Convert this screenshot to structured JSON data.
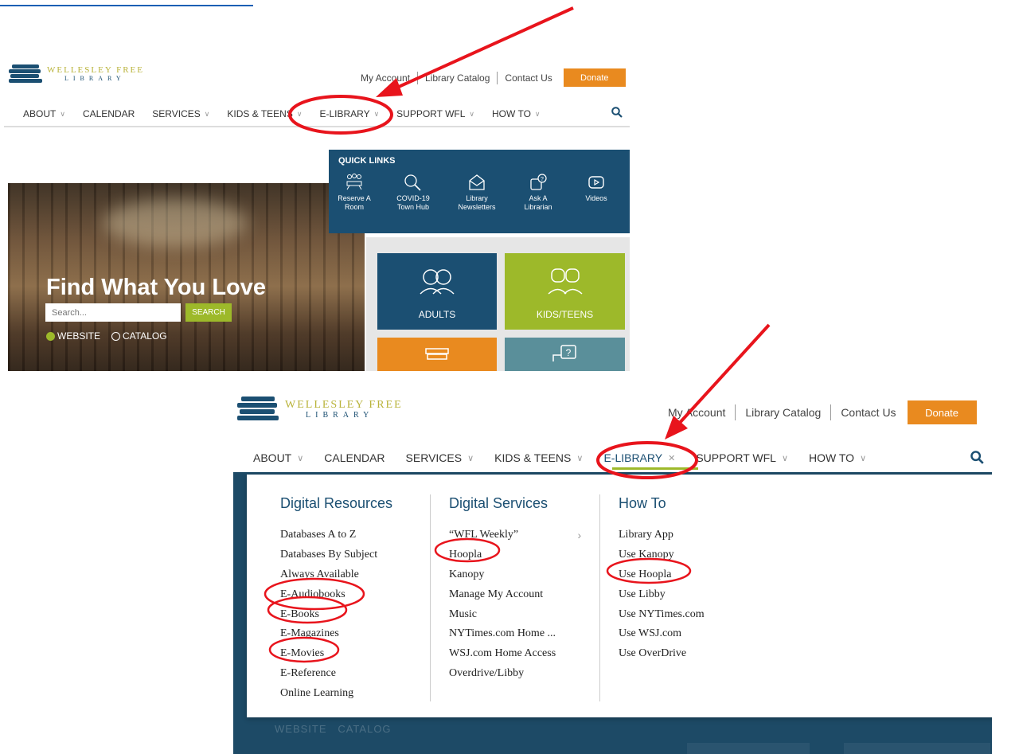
{
  "site": {
    "logo_line1": "WELLESLEY FREE",
    "logo_line2": "LIBRARY"
  },
  "utility": {
    "my_account": "My Account",
    "library_catalog": "Library Catalog",
    "contact_us": "Contact Us",
    "donate": "Donate"
  },
  "nav": [
    {
      "label": "ABOUT",
      "chevron": true
    },
    {
      "label": "CALENDAR",
      "chevron": false
    },
    {
      "label": "SERVICES",
      "chevron": true
    },
    {
      "label": "KIDS & TEENS",
      "chevron": true
    },
    {
      "label": "E-LIBRARY",
      "chevron": true
    },
    {
      "label": "SUPPORT WFL",
      "chevron": true
    },
    {
      "label": "HOW TO",
      "chevron": true
    }
  ],
  "quick_links": {
    "title": "QUICK LINKS",
    "items": [
      {
        "line1": "Reserve A",
        "line2": "Room",
        "icon": "meeting-room-icon"
      },
      {
        "line1": "COVID-19",
        "line2": "Town Hub",
        "icon": "magnifier-icon"
      },
      {
        "line1": "Library",
        "line2": "Newsletters",
        "icon": "envelope-icon"
      },
      {
        "line1": "Ask A",
        "line2": "Librarian",
        "icon": "question-bubble-icon"
      },
      {
        "line1": "Videos",
        "line2": "",
        "icon": "play-icon"
      }
    ]
  },
  "hero": {
    "title": "Find What You Love",
    "search_placeholder": "Search...",
    "search_button": "SEARCH",
    "radio_website": "WEBSITE",
    "radio_catalog": "CATALOG"
  },
  "tiles": {
    "adults": "ADULTS",
    "kids_teens": "KIDS/TEENS"
  },
  "mega_menu": {
    "columns": [
      {
        "heading": "Digital Resources",
        "items": [
          "Databases A to Z",
          "Databases By Subject",
          "Always Available",
          "E-Audiobooks",
          "E-Books",
          "E-Magazines",
          "E-Movies",
          "E-Reference",
          "Online Learning"
        ]
      },
      {
        "heading": "Digital Services",
        "items": [
          "“WFL Weekly”",
          "Hoopla",
          "Kanopy",
          "Manage My Account",
          "Music",
          "NYTimes.com Home ...",
          "WSJ.com Home Access",
          "Overdrive/Libby"
        ]
      },
      {
        "heading": "How To",
        "items": [
          "Library App",
          "Use Kanopy",
          "Use Hoopla",
          "Use Libby",
          "Use NYTimes.com",
          "Use WSJ.com",
          "Use OverDrive"
        ]
      }
    ],
    "background_ghost_text": "WEBSITE   CATALOG"
  },
  "colors": {
    "brand_navy": "#1b4f72",
    "accent_green": "#9db92a",
    "donate_orange": "#e98a1f",
    "annotation_red": "#e8141c"
  }
}
